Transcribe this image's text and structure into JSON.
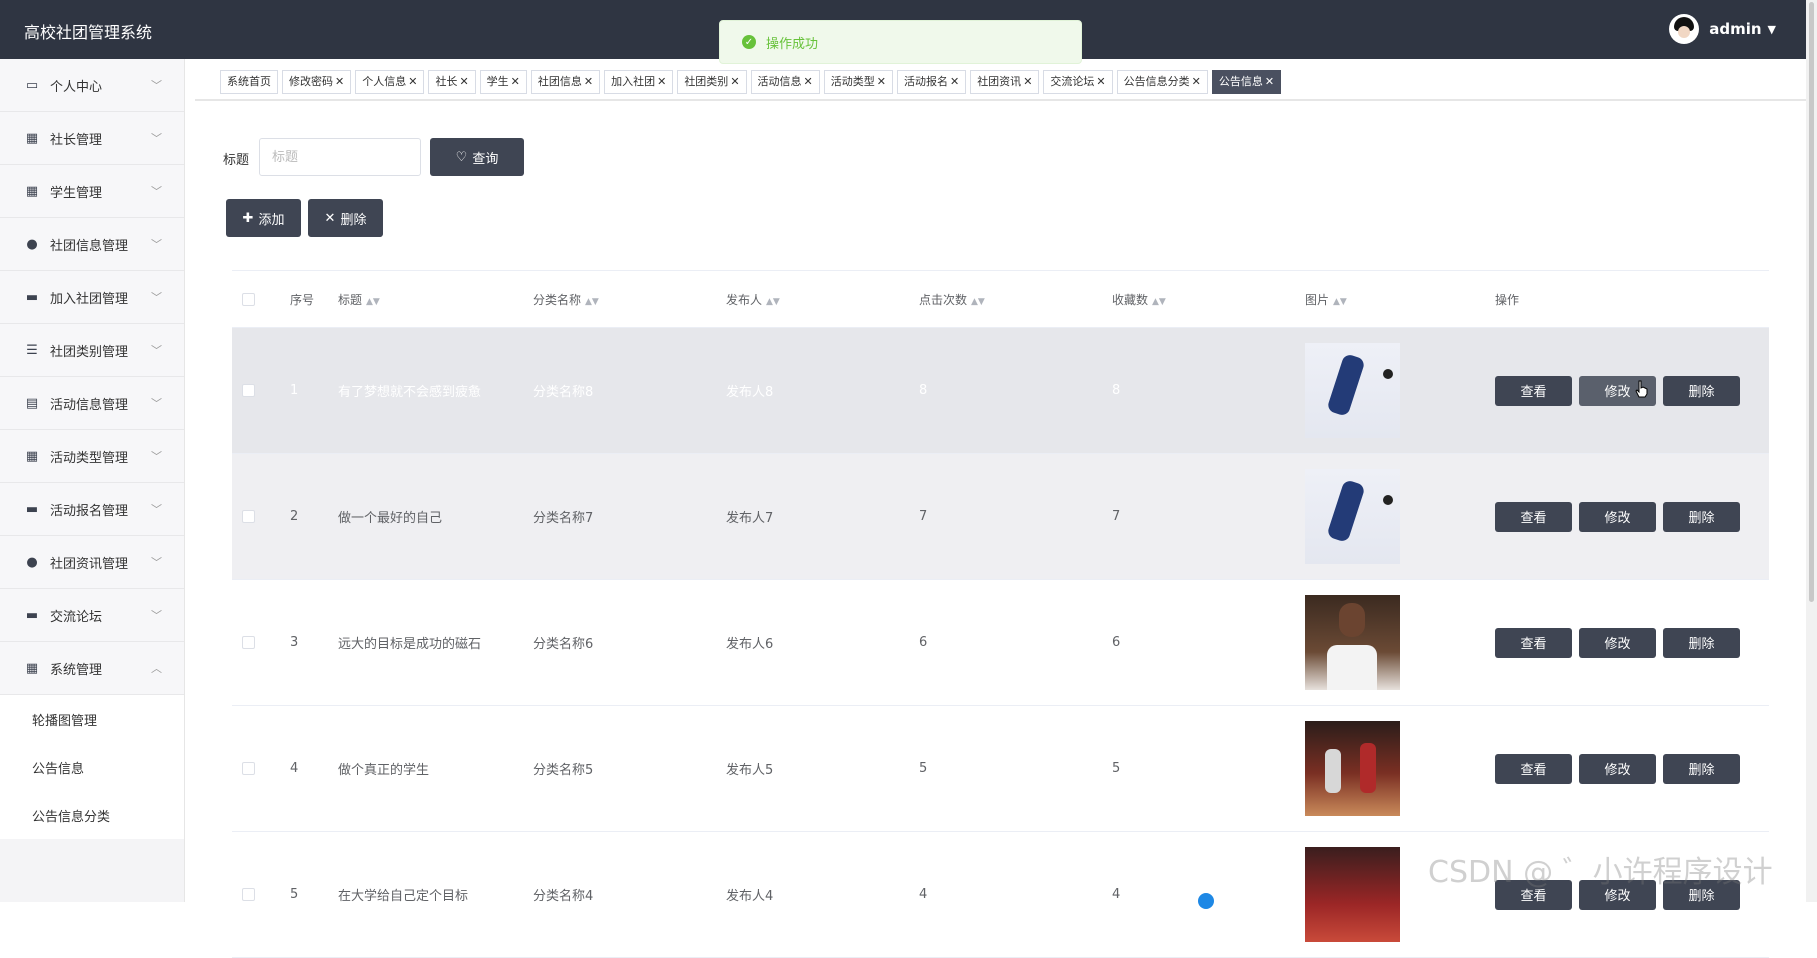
{
  "app": {
    "title": "高校社团管理系统",
    "user": "admin"
  },
  "toast": {
    "message": "操作成功"
  },
  "sidebar": {
    "items": [
      {
        "label": "个人中心",
        "icon": "id-card-icon"
      },
      {
        "label": "社长管理",
        "icon": "grid-icon"
      },
      {
        "label": "学生管理",
        "icon": "grid-icon"
      },
      {
        "label": "社团信息管理",
        "icon": "person-icon"
      },
      {
        "label": "加入社团管理",
        "icon": "flag-icon"
      },
      {
        "label": "社团类别管理",
        "icon": "list-icon"
      },
      {
        "label": "活动信息管理",
        "icon": "clipboard-icon"
      },
      {
        "label": "活动类型管理",
        "icon": "grid-icon"
      },
      {
        "label": "活动报名管理",
        "icon": "monitor-icon"
      },
      {
        "label": "社团资讯管理",
        "icon": "person-icon"
      },
      {
        "label": "交流论坛",
        "icon": "chat-icon"
      },
      {
        "label": "系统管理",
        "icon": "grid-icon"
      }
    ],
    "sub_items": [
      {
        "label": "轮播图管理"
      },
      {
        "label": "公告信息"
      },
      {
        "label": "公告信息分类"
      }
    ]
  },
  "tabs": [
    {
      "label": "系统首页",
      "closable": false
    },
    {
      "label": "修改密码",
      "closable": true
    },
    {
      "label": "个人信息",
      "closable": true
    },
    {
      "label": "社长",
      "closable": true
    },
    {
      "label": "学生",
      "closable": true
    },
    {
      "label": "社团信息",
      "closable": true
    },
    {
      "label": "加入社团",
      "closable": true
    },
    {
      "label": "社团类别",
      "closable": true
    },
    {
      "label": "活动信息",
      "closable": true
    },
    {
      "label": "活动类型",
      "closable": true
    },
    {
      "label": "活动报名",
      "closable": true
    },
    {
      "label": "社团资讯",
      "closable": true
    },
    {
      "label": "交流论坛",
      "closable": true
    },
    {
      "label": "公告信息分类",
      "closable": true
    },
    {
      "label": "公告信息",
      "closable": true,
      "active": true
    }
  ],
  "search": {
    "label": "标题",
    "placeholder": "标题",
    "button": "查询"
  },
  "actions": {
    "add": "添加",
    "delete": "删除"
  },
  "table": {
    "headers": {
      "index": "序号",
      "title": "标题",
      "category": "分类名称",
      "publisher": "发布人",
      "clicks": "点击次数",
      "favorites": "收藏数",
      "image": "图片",
      "ops": "操作"
    },
    "rows": [
      {
        "index": "1",
        "title": "有了梦想就不会感到疲惫",
        "category": "分类名称8",
        "publisher": "发布人8",
        "clicks": "8",
        "favorites": "8",
        "image": "basketball-player-jump"
      },
      {
        "index": "2",
        "title": "做一个最好的自己",
        "category": "分类名称7",
        "publisher": "发布人7",
        "clicks": "7",
        "favorites": "7",
        "image": "basketball-player-jump"
      },
      {
        "index": "3",
        "title": "远大的目标是成功的磁石",
        "category": "分类名称6",
        "publisher": "发布人6",
        "clicks": "6",
        "favorites": "6",
        "image": "basketball-player-portrait"
      },
      {
        "index": "4",
        "title": "做个真正的学生",
        "category": "分类名称5",
        "publisher": "发布人5",
        "clicks": "5",
        "favorites": "5",
        "image": "basketball-game"
      },
      {
        "index": "5",
        "title": "在大学给自己定个目标",
        "category": "分类名称4",
        "publisher": "发布人4",
        "clicks": "4",
        "favorites": "4",
        "image": "basketball-team"
      }
    ],
    "ops": {
      "view": "查看",
      "edit": "修改",
      "delete": "删除"
    }
  },
  "watermark": "CSDN @ ゛小许程序设计"
}
